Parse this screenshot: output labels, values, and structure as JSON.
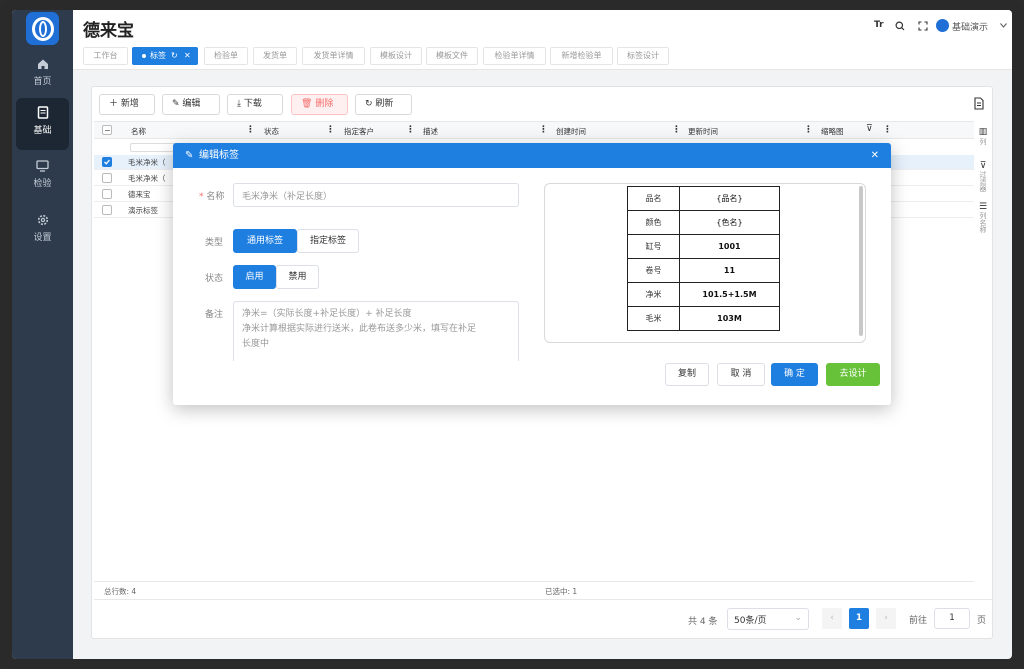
{
  "app": {
    "title": "德来宝",
    "user": "基础演示",
    "font_btn": "Tr"
  },
  "sidebar": {
    "items": [
      {
        "label": "首页",
        "icon": "home-icon"
      },
      {
        "label": "基础",
        "icon": "document-icon"
      },
      {
        "label": "检验",
        "icon": "monitor-icon"
      },
      {
        "label": "设置",
        "icon": "gear-icon"
      }
    ]
  },
  "tabs": [
    {
      "label": "工作台"
    },
    {
      "label": "标签"
    },
    {
      "label": "检验单"
    },
    {
      "label": "发货单"
    },
    {
      "label": "发货单详情"
    },
    {
      "label": "模板设计"
    },
    {
      "label": "模板文件"
    },
    {
      "label": "检验单详情"
    },
    {
      "label": "新增检验单"
    },
    {
      "label": "标签设计"
    }
  ],
  "toolbar": {
    "add": "新增",
    "edit": "编辑",
    "download": "下载",
    "delete": "删除",
    "refresh": "刷新"
  },
  "table": {
    "columns": [
      "名称",
      "状态",
      "指定客户",
      "描述",
      "创建时间",
      "更新时间",
      "缩略图"
    ],
    "rows": [
      {
        "name": "毛米净米（",
        "selected": true
      },
      {
        "name": "毛米净米（",
        "selected": false
      },
      {
        "name": "德来宝",
        "selected": false
      },
      {
        "name": "演示标签",
        "selected": false
      }
    ]
  },
  "right_panel": {
    "columns": "列",
    "filter": "过滤器",
    "names": "列名称"
  },
  "footer": {
    "total": "总行数: 4",
    "selected": "已选中: 1"
  },
  "pagination": {
    "total": "共 4 条",
    "page_size": "50条/页",
    "current": "1",
    "goto_label": "前往",
    "goto_value": "1",
    "page_unit": "页"
  },
  "dialog": {
    "title": "编辑标签",
    "name_label": "名称",
    "name_value": "毛米净米（补足长度）",
    "type_label": "类型",
    "type_options": [
      "通用标签",
      "指定标签"
    ],
    "status_label": "状态",
    "status_options": [
      "启用",
      "禁用"
    ],
    "remark_label": "备注",
    "remark_lines": [
      "净米=（实际长度+补足长度）+ 补足长度",
      "净米计算根据实际进行送米，此卷布送多少米，填写在补足",
      "长度中"
    ],
    "buttons": {
      "copy": "复制",
      "cancel": "取 消",
      "confirm": "确 定",
      "design": "去设计"
    },
    "label_preview": [
      {
        "k": "品名",
        "v": "{品名}"
      },
      {
        "k": "颜色",
        "v": "{色名}"
      },
      {
        "k": "缸号",
        "v": "1001"
      },
      {
        "k": "卷号",
        "v": "11"
      },
      {
        "k": "净米",
        "v": "101.5+1.5M"
      },
      {
        "k": "毛米",
        "v": "103M"
      }
    ]
  },
  "colors": {
    "primary": "#1f7fe0",
    "sidebar": "#2d3b4d",
    "success": "#67c23a",
    "danger": "#f56c6c"
  }
}
